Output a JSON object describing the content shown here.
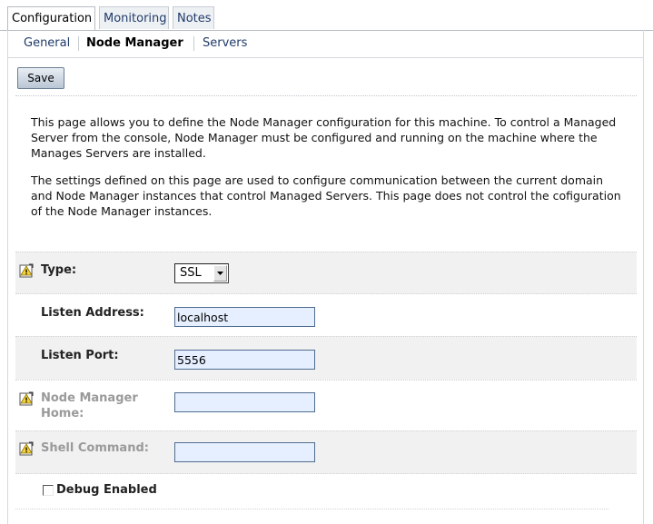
{
  "tabs": [
    {
      "label": "Configuration",
      "active": true
    },
    {
      "label": "Monitoring",
      "active": false
    },
    {
      "label": "Notes",
      "active": false
    }
  ],
  "subtabs": [
    {
      "label": "General",
      "active": false
    },
    {
      "label": "Node Manager",
      "active": true
    },
    {
      "label": "Servers",
      "active": false
    }
  ],
  "toolbar": {
    "save_label": "Save"
  },
  "description": {
    "p1": "This page allows you to define the Node Manager configuration for this machine. To control a Managed Server from the console, Node Manager must be configured and running on the machine where the Manages Servers are installed.",
    "p2": "The settings defined on this page are used to configure communication between the current domain and Node Manager instances that control Managed Servers. This page does not control the cofiguration of the Node Manager instances."
  },
  "form": {
    "type": {
      "label": "Type:",
      "value": "SSL"
    },
    "listen_address": {
      "label": "Listen Address:",
      "value": "localhost"
    },
    "listen_port": {
      "label": "Listen Port:",
      "value": "5556"
    },
    "node_manager_home": {
      "label_line1": "Node Manager",
      "label_line2": "Home:",
      "value": ""
    },
    "shell_command": {
      "label": "Shell Command:",
      "value": ""
    },
    "debug_enabled": {
      "label": "Debug Enabled",
      "checked": false
    }
  },
  "icons": {
    "warning": "restart-required-warning-icon"
  },
  "colors": {
    "link": "#1f3a6a",
    "field_bg": "#e6efff",
    "field_border": "#4f6c8f",
    "row_bg": "#f1f1f1"
  }
}
